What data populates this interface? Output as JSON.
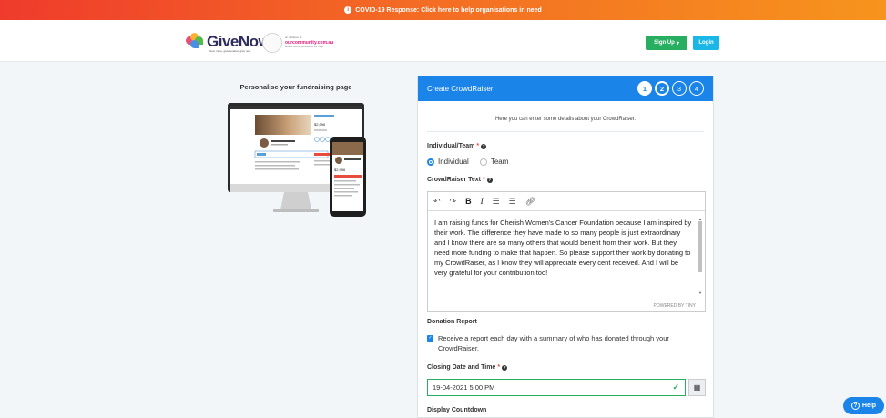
{
  "banner": {
    "text": "COVID-19 Response: Click here to help organisations in need",
    "icon": "info-circle-icon"
  },
  "header": {
    "logo_name": "GiveNow",
    "logo_tagline": "Give more, give smarter, give now",
    "partner_prefix": "an initiative of",
    "partner_name": "ourcommunity.com.au",
    "partner_tagline": "where not-for-profits go for help",
    "signup_label": "Sign Up",
    "login_label": "Login"
  },
  "left": {
    "title": "Personalise your fundraising page",
    "preview": {
      "desktop_amount": "$2,996",
      "mobile_amount": "$2,996"
    }
  },
  "card": {
    "title": "Create CrowdRaiser",
    "steps": [
      "1",
      "2",
      "3",
      "4"
    ],
    "active_step": 1,
    "intro": "Here you can enter some details about your CrowdRaiser.",
    "individual_team": {
      "label": "Individual/Team",
      "options": [
        "Individual",
        "Team"
      ],
      "selected": "Individual"
    },
    "crowdraiser_text": {
      "label": "CrowdRaiser Text",
      "content": "I am raising funds for Cherish Women's Cancer Foundation because I am inspired by their work. The difference they have made to so many people is just extraordinary and I know there are so many others that would benefit from their work. But they need more funding to make that happen. So please support their work by donating to my CrowdRaiser, as I know they will appreciate every cent received. And I will be very grateful for your contribution too!",
      "powered_by": "POWERED BY TINY"
    },
    "donation_report": {
      "label": "Donation Report",
      "checkbox_text": "Receive a report each day with a summary of who has donated through your CrowdRaiser.",
      "checked": true
    },
    "closing_date": {
      "label": "Closing Date and Time",
      "value": "19-04-2021 5:00 PM"
    },
    "display_countdown": {
      "label": "Display Countdown"
    }
  },
  "help": {
    "label": "Help"
  },
  "colors": {
    "primary": "#1a84e8",
    "success": "#27ae60",
    "banner_start": "#ef3b2c",
    "banner_end": "#f7941d",
    "login": "#1ab7e6"
  }
}
